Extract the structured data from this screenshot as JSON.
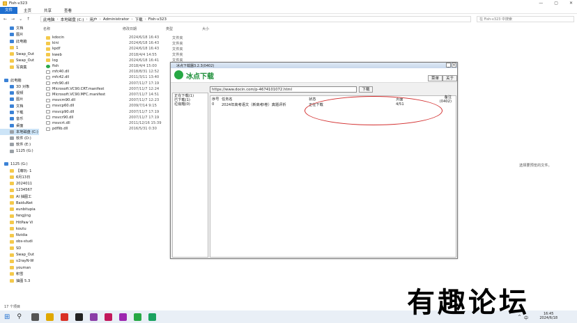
{
  "window": {
    "title": "Fish-v323",
    "controls": [
      "—",
      "▢",
      "✕"
    ]
  },
  "ribbon": {
    "tabs": [
      "文件",
      "主页",
      "共享",
      "查看"
    ]
  },
  "address": {
    "path": [
      "此电脑",
      "本地磁盘 (C:)",
      "用户",
      "Administrator",
      "下载",
      "Fish-v323"
    ],
    "search_placeholder": "在 Fish-v323 中搜索"
  },
  "sidebar": {
    "items": [
      {
        "label": "文档",
        "icon": "document-icon",
        "kind": "blue"
      },
      {
        "label": "图片",
        "icon": "picture-icon",
        "kind": "blue"
      },
      {
        "label": "此电脑",
        "icon": "computer-icon",
        "kind": "blue"
      },
      {
        "label": "1",
        "icon": "folder-icon",
        "kind": ""
      },
      {
        "label": "Swap_Out",
        "icon": "folder-icon",
        "kind": ""
      },
      {
        "label": "Swap_Out",
        "icon": "folder-icon",
        "kind": ""
      },
      {
        "label": "写真集",
        "icon": "folder-icon",
        "kind": ""
      },
      {
        "label": "",
        "icon": "",
        "kind": "spacer"
      },
      {
        "label": "此电脑",
        "icon": "computer-icon",
        "kind": "hdr"
      },
      {
        "label": "3D 对象",
        "icon": "cube-icon",
        "kind": "blue"
      },
      {
        "label": "视频",
        "icon": "video-icon",
        "kind": "blue"
      },
      {
        "label": "图片",
        "icon": "picture-icon",
        "kind": "blue"
      },
      {
        "label": "文档",
        "icon": "document-icon",
        "kind": "blue"
      },
      {
        "label": "下载",
        "icon": "download-icon",
        "kind": "blue"
      },
      {
        "label": "音乐",
        "icon": "music-icon",
        "kind": "blue"
      },
      {
        "label": "桌面",
        "icon": "desktop-icon",
        "kind": "blue"
      },
      {
        "label": "本地磁盘 (C:)",
        "icon": "drive-icon",
        "kind": "drive sel"
      },
      {
        "label": "软件 (D:)",
        "icon": "drive-icon",
        "kind": "drive"
      },
      {
        "label": "软件 (E:)",
        "icon": "drive-icon",
        "kind": "drive"
      },
      {
        "label": "1125 (G:)",
        "icon": "drive-icon",
        "kind": "drive"
      },
      {
        "label": "",
        "icon": "",
        "kind": "spacer"
      },
      {
        "label": "1125 (G:)",
        "icon": "drive-icon",
        "kind": "hdr"
      },
      {
        "label": "【痛玩- 1",
        "icon": "folder-icon",
        "kind": ""
      },
      {
        "label": "6月13日",
        "icon": "folder-icon",
        "kind": ""
      },
      {
        "label": "2024011",
        "icon": "folder-icon",
        "kind": ""
      },
      {
        "label": "1234567",
        "icon": "folder-icon",
        "kind": ""
      },
      {
        "label": "AI 抽图工",
        "icon": "folder-icon",
        "kind": ""
      },
      {
        "label": "BaiduNet",
        "icon": "folder-icon",
        "kind": ""
      },
      {
        "label": "eunbitupia",
        "icon": "folder-icon",
        "kind": ""
      },
      {
        "label": "fengjing",
        "icon": "folder-icon",
        "kind": ""
      },
      {
        "label": "HitPaw Vi",
        "icon": "folder-icon",
        "kind": ""
      },
      {
        "label": "koutu",
        "icon": "folder-icon",
        "kind": ""
      },
      {
        "label": "Nvidia",
        "icon": "folder-icon",
        "kind": ""
      },
      {
        "label": "obs-studi",
        "icon": "folder-icon",
        "kind": ""
      },
      {
        "label": "SD",
        "icon": "folder-icon",
        "kind": ""
      },
      {
        "label": "Swap_Out",
        "icon": "folder-icon",
        "kind": ""
      },
      {
        "label": "v2rayN-W",
        "icon": "folder-icon",
        "kind": ""
      },
      {
        "label": "youman",
        "icon": "folder-icon",
        "kind": ""
      },
      {
        "label": "积雪",
        "icon": "folder-icon",
        "kind": ""
      },
      {
        "label": "抽图 5.3",
        "icon": "folder-icon",
        "kind": ""
      }
    ]
  },
  "columns": [
    "名称",
    "修改日期",
    "类型",
    "大小"
  ],
  "files": [
    {
      "name": "kdocin",
      "date": "2024/6/18 16:43",
      "type": "文件夹",
      "kind": "folder"
    },
    {
      "name": "kini",
      "date": "2024/6/18 16:43",
      "type": "文件夹",
      "kind": "folder"
    },
    {
      "name": "kpdf",
      "date": "2024/6/18 16:43",
      "type": "文件夹",
      "kind": "folder"
    },
    {
      "name": "kweb",
      "date": "2018/4/4 14:55",
      "type": "文件夹",
      "kind": "folder"
    },
    {
      "name": "log",
      "date": "2024/6/18 16:41",
      "type": "文件夹",
      "kind": "folder"
    },
    {
      "name": "fish",
      "date": "2018/4/4 15:00",
      "type": "应",
      "kind": "green"
    },
    {
      "name": "mfc40.dll",
      "date": "2018/8/31 12:52",
      "type": "应",
      "kind": "doc"
    },
    {
      "name": "mfc42.dll",
      "date": "2011/3/11 13:40",
      "type": "应",
      "kind": "doc"
    },
    {
      "name": "mfc90.dll",
      "date": "2007/11/7 17:19",
      "type": "应",
      "kind": "doc"
    },
    {
      "name": "Microsoft.VC90.CRT.manifest",
      "date": "2007/11/7 12:24",
      "type": "M",
      "kind": "doc"
    },
    {
      "name": "Microsoft.VC90.MFC.manifest",
      "date": "2007/11/7 14:51",
      "type": "M",
      "kind": "doc"
    },
    {
      "name": "msvcm90.dll",
      "date": "2007/11/7 12:23",
      "type": "应",
      "kind": "doc"
    },
    {
      "name": "msvcp60.dll",
      "date": "2009/7/14 9:15",
      "type": "应",
      "kind": "doc"
    },
    {
      "name": "msvcp90.dll",
      "date": "2007/11/7 17:19",
      "type": "应",
      "kind": "doc"
    },
    {
      "name": "msvcr90.dll",
      "date": "2007/11/7 17:19",
      "type": "应",
      "kind": "doc"
    },
    {
      "name": "msvcrt.dll",
      "date": "2011/12/16 15:39",
      "type": "应",
      "kind": "doc"
    },
    {
      "name": "pdflib.dll",
      "date": "2016/5/31 0:30",
      "type": "应",
      "kind": "doc"
    }
  ],
  "preview_hint": "选择要预览的文件。",
  "status": {
    "count": "17 个项目"
  },
  "taskbar": {
    "apps": [
      "search-icon",
      "task-view-icon",
      "explorer-icon",
      "chrome-icon",
      "capcut-icon",
      "app-icon",
      "app-icon",
      "app-icon",
      "bingdian-icon",
      "app-icon"
    ],
    "time": "16:45",
    "date": "2024/6/18",
    "ime": "中",
    "lang": "^"
  },
  "dialog": {
    "title": "冰点下载器3.2.3(0402)",
    "ctrls": [
      "_",
      "✕"
    ],
    "brand": "冰点下载",
    "menu_label": "菜单",
    "about_label": "关于",
    "url": "https://www.docin.com/p-4674101072.html",
    "download_label": "下载",
    "left": [
      "正在下载(1)",
      "已下载(1)",
      "垃圾箱(0)"
    ],
    "headers": [
      "序号",
      "任务名",
      "状态",
      "页面",
      "备注(0402)"
    ],
    "rows": [
      {
        "id": "0",
        "name": "2024年高考语文（新高考I卷）真题评析",
        "state": "正在下载",
        "pages": "4/51",
        "note": ""
      }
    ]
  },
  "watermark": "有趣论坛",
  "colors": {
    "accent": "#1f6fd0",
    "brand_green": "#1f8f3a",
    "annotation_red": "#d32f2f"
  }
}
